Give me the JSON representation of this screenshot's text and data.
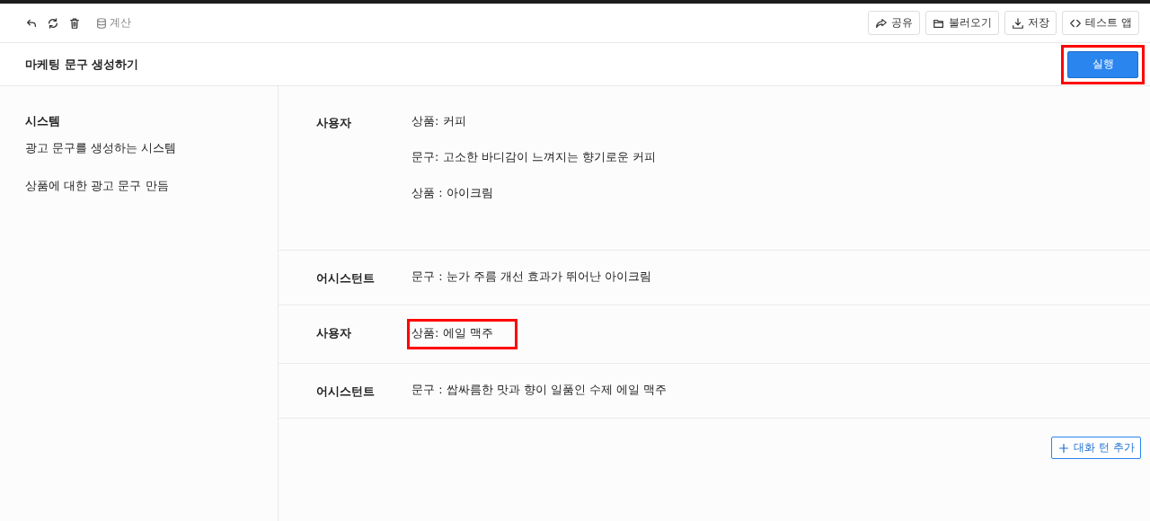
{
  "toolbar": {
    "left_icons": [
      {
        "kind": "undo"
      },
      {
        "kind": "refresh"
      },
      {
        "kind": "trash"
      }
    ],
    "calc": {
      "label": "계산",
      "disabled": true
    },
    "buttons": [
      {
        "kind": "share",
        "label": "공유"
      },
      {
        "kind": "open",
        "label": "불러오기"
      },
      {
        "kind": "save",
        "label": "저장"
      },
      {
        "kind": "code",
        "label": "테스트 앱"
      }
    ]
  },
  "header": {
    "title": "마케팅 문구 생성하기",
    "run_button": {
      "label": "실행",
      "highlighted": true
    }
  },
  "system": {
    "heading": "시스템",
    "lines": [
      "광고 문구를 생성하는 시스템",
      "상품에 대한 광고 문구 만듬"
    ]
  },
  "messages": [
    {
      "role": "사용자",
      "lines": [
        {
          "text": "상품: 커피",
          "highlighted": false
        },
        {
          "text": "문구: 고소한 바디감이 느껴지는 향기로운 커피",
          "highlighted": false
        },
        {
          "text": "상품 : 아이크림",
          "highlighted": false
        }
      ]
    },
    {
      "role": "어시스턴트",
      "lines": [
        {
          "text": "문구 : 눈가 주름 개선 효과가 뛰어난 아이크림",
          "highlighted": false
        }
      ]
    },
    {
      "role": "사용자",
      "lines": [
        {
          "text": "상품: 에일 맥주",
          "highlighted": true
        }
      ]
    },
    {
      "role": "어시스턴트",
      "lines": [
        {
          "text": "문구 : 쌉싸름한 맛과 향이 일품인 수제 에일 맥주",
          "highlighted": false
        }
      ]
    }
  ],
  "add_turn_button": {
    "label": "대화 턴 추가"
  }
}
